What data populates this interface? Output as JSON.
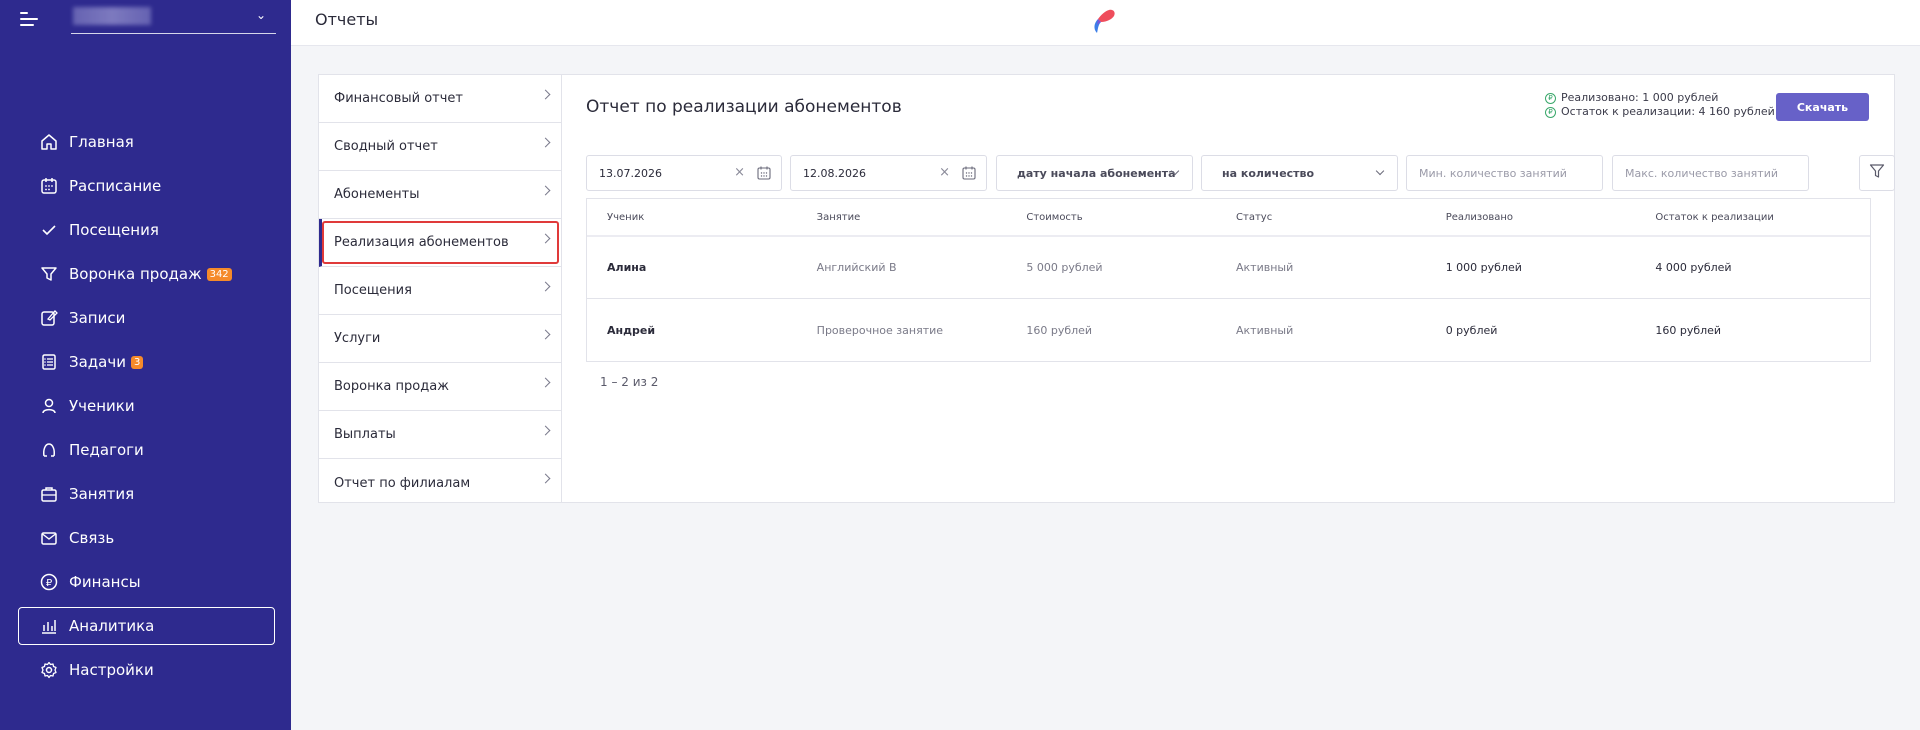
{
  "sidebar": {
    "org_name": "",
    "items": [
      {
        "label": "Главная",
        "icon": "home-icon"
      },
      {
        "label": "Расписание",
        "icon": "calendar-icon"
      },
      {
        "label": "Посещения",
        "icon": "check-icon"
      },
      {
        "label": "Воронка продаж",
        "icon": "funnel-icon",
        "badge": "342"
      },
      {
        "label": "Записи",
        "icon": "edit-icon"
      },
      {
        "label": "Задачи",
        "icon": "tasks-icon",
        "badge": "3"
      },
      {
        "label": "Ученики",
        "icon": "user-icon"
      },
      {
        "label": "Педагоги",
        "icon": "teacher-icon"
      },
      {
        "label": "Занятия",
        "icon": "briefcase-icon"
      },
      {
        "label": "Связь",
        "icon": "mail-icon"
      },
      {
        "label": "Финансы",
        "icon": "ruble-icon"
      },
      {
        "label": "Аналитика",
        "icon": "analytics-icon",
        "active": true
      },
      {
        "label": "Настройки",
        "icon": "settings-icon"
      }
    ]
  },
  "header": {
    "title": "Отчеты"
  },
  "report_menu": [
    {
      "label": "Финансовый отчет"
    },
    {
      "label": "Сводный отчет"
    },
    {
      "label": "Абонементы"
    },
    {
      "label": "Реализация абонементов",
      "active": true
    },
    {
      "label": "Посещения"
    },
    {
      "label": "Услуги"
    },
    {
      "label": "Воронка продаж"
    },
    {
      "label": "Выплаты"
    },
    {
      "label": "Отчет по филиалам"
    }
  ],
  "report": {
    "title": "Отчет по реализации абонементов",
    "summary_realized": "Реализовано: 1 000 рублей",
    "summary_remaining": "Остаток к реализации: 4 160 рублей",
    "download_label": "Скачать",
    "filters": {
      "date_from": "13.07.2026",
      "date_to": "12.08.2026",
      "date_type": "дату начала абонемента",
      "count_type": "на количество",
      "min_placeholder": "Мин. количество занятий",
      "max_placeholder": "Макс. количество занятий"
    },
    "columns": [
      "Ученик",
      "Занятие",
      "Стоимость",
      "Статус",
      "Реализовано",
      "Остаток к реализации"
    ],
    "rows": [
      [
        "Алина",
        "Английский B",
        "5 000 рублей",
        "Активный",
        "1 000 рублей",
        "4 000 рублей"
      ],
      [
        "Андрей",
        "Проверочное занятие",
        "160 рублей",
        "Активный",
        "0 рублей",
        "160 рублей"
      ]
    ],
    "pagination": "1 – 2 из 2"
  },
  "colors": {
    "sidebar_bg": "#2e2a8e",
    "accent": "#6761c8",
    "badge": "#f58a2a",
    "highlight": "#e03a3a"
  }
}
